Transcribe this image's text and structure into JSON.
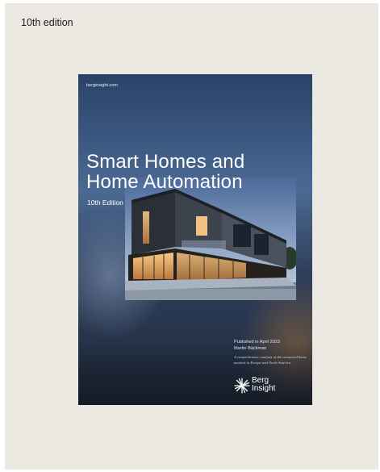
{
  "edition_label": "10th edition",
  "cover": {
    "site": "berginsight.com",
    "title_line1": "Smart Homes and",
    "title_line2": "Home Automation",
    "edition": "10th Edition",
    "published": "Published in April 2023",
    "author": "Martin Bäckman",
    "description": "A comprehensive analysis of the connected home markets in Europe and North America.",
    "logo_line1": "Berg",
    "logo_line2": "Insight"
  },
  "icons": [
    "house-photo",
    "berg-insight-logo-icon"
  ]
}
